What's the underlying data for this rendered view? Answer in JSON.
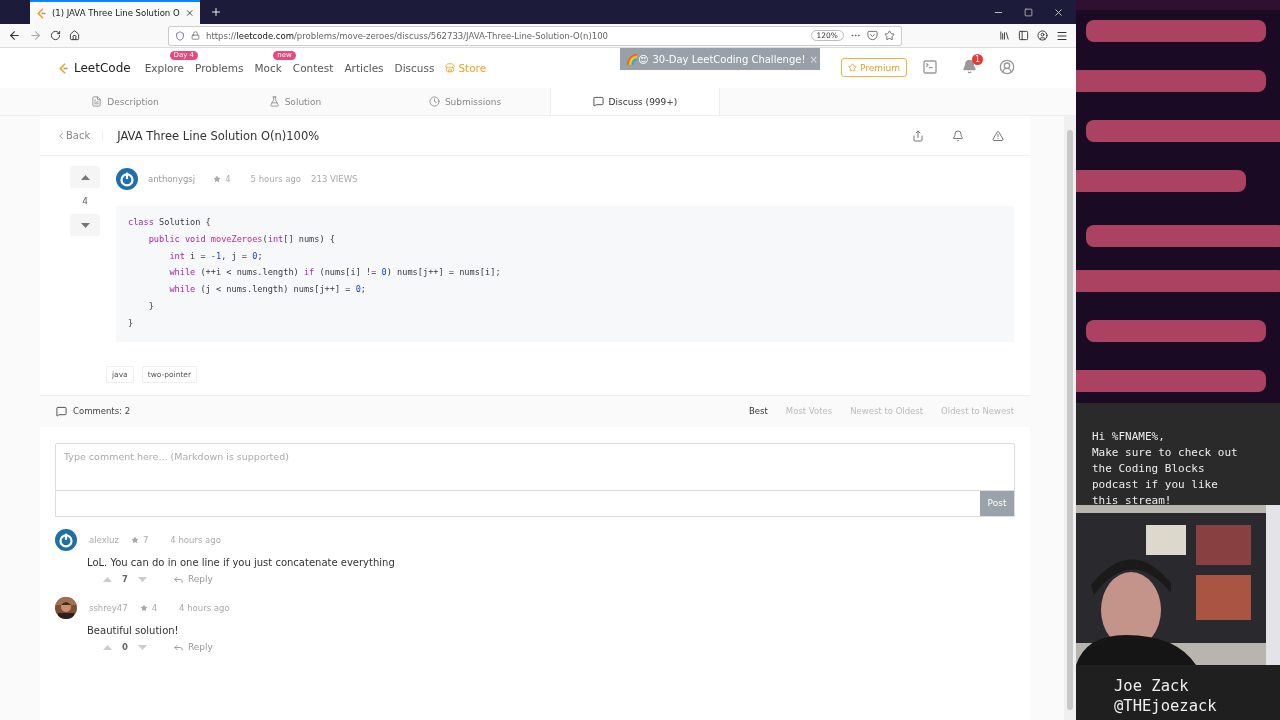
{
  "browser": {
    "tab_title": "(1) JAVA Three Line Solution O",
    "url": {
      "scheme": "https://",
      "host": "leetcode.com",
      "path": "/problems/move-zeroes/discuss/562733/JAVA-Three-Line-Solution-O(n)100"
    },
    "zoom": "120%"
  },
  "nav": {
    "logo": "LeetCode",
    "items": [
      {
        "label": "Explore",
        "badge": "Day 4",
        "kind": "link"
      },
      {
        "label": "Problems",
        "kind": "link"
      },
      {
        "label": "Mock",
        "badge": "new",
        "kind": "link"
      },
      {
        "label": "Contest",
        "kind": "link"
      },
      {
        "label": "Articles",
        "kind": "link"
      },
      {
        "label": "Discuss",
        "kind": "link"
      },
      {
        "label": "Store",
        "kind": "store"
      }
    ],
    "banner_emoji": "🌈😍",
    "banner": "30-Day LeetCoding Challenge!",
    "banner_close": "×",
    "premium": "Premium",
    "notification_count": "1"
  },
  "problem_tabs": [
    {
      "label": "Description",
      "selected": false
    },
    {
      "label": "Solution",
      "selected": false
    },
    {
      "label": "Submissions",
      "selected": false
    },
    {
      "label": "Discuss (999+)",
      "selected": true
    }
  ],
  "post": {
    "back": "Back",
    "title": "JAVA Three Line Solution O(n)100%",
    "votes": "4",
    "author": "anthonygsj",
    "reputation": "4",
    "time": "5 hours ago",
    "views": "213 VIEWS",
    "code": [
      [
        {
          "text": "class",
          "kind": "keyword"
        },
        {
          "text": " Solution {",
          "kind": "plain"
        }
      ],
      [
        {
          "text": "    public void",
          "kind": "keyword"
        },
        {
          "text": " moveZeroes",
          "kind": "function"
        },
        {
          "text": "(",
          "kind": "plain"
        },
        {
          "text": "int",
          "kind": "keyword"
        },
        {
          "text": "[] nums) {",
          "kind": "plain"
        }
      ],
      [
        {
          "text": "        int",
          "kind": "keyword"
        },
        {
          "text": " i = ",
          "kind": "plain"
        },
        {
          "text": "-1",
          "kind": "number"
        },
        {
          "text": ", j = ",
          "kind": "plain"
        },
        {
          "text": "0",
          "kind": "number"
        },
        {
          "text": ";",
          "kind": "plain"
        }
      ],
      [
        {
          "text": "        while",
          "kind": "keyword"
        },
        {
          "text": " (++i < nums.length) ",
          "kind": "plain"
        },
        {
          "text": "if",
          "kind": "keyword"
        },
        {
          "text": " (nums[i] != ",
          "kind": "plain"
        },
        {
          "text": "0",
          "kind": "number"
        },
        {
          "text": ") nums[j++] = nums[i];",
          "kind": "plain"
        }
      ],
      [
        {
          "text": "        while",
          "kind": "keyword"
        },
        {
          "text": " (j < nums.length) nums[j++] = ",
          "kind": "plain"
        },
        {
          "text": "0",
          "kind": "number"
        },
        {
          "text": ";",
          "kind": "plain"
        }
      ],
      [
        {
          "text": "    }",
          "kind": "plain"
        }
      ],
      [
        {
          "text": "}",
          "kind": "plain"
        }
      ]
    ],
    "tags": [
      "java",
      "two-pointer"
    ]
  },
  "comments": {
    "count": "Comments: 2",
    "sort": [
      {
        "label": "Best",
        "selected": true
      },
      {
        "label": "Most Votes",
        "selected": false
      },
      {
        "label": "Newest to Oldest",
        "selected": false
      },
      {
        "label": "Oldest to Newest",
        "selected": false
      }
    ],
    "placeholder": "Type comment here... (Markdown is supported)",
    "post_button": "Post",
    "items": [
      {
        "author": "alexluz",
        "kind": "default",
        "reputation": "7",
        "time": "4 hours ago",
        "text": "LoL. You can do in one line if you just concatenate everything",
        "votes": "7",
        "reply": "Reply"
      },
      {
        "author": "sshrey47",
        "reputation": "4",
        "time": "4 hours ago",
        "text": "Beautiful solution!",
        "votes": "0",
        "reply": "Reply"
      }
    ]
  },
  "overlay": {
    "background": {
      "kind": "picture"
    },
    "message": [
      "Hi %FNAME%,",
      "Make sure to check out",
      "the Coding Blocks",
      "podcast if you like",
      "this stream!"
    ],
    "webcam": {
      "kind": "picture"
    },
    "name": "Joe Zack",
    "handle": "@THEjoezack"
  }
}
